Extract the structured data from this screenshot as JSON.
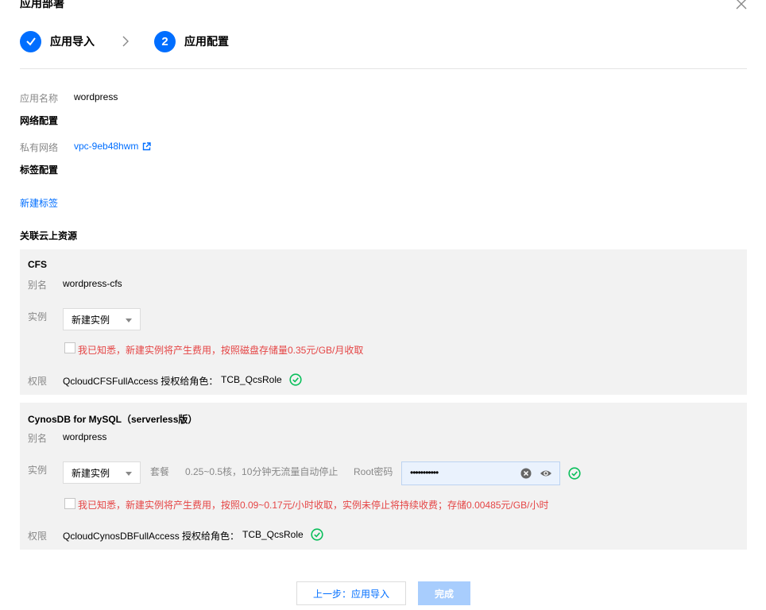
{
  "dialog": {
    "title": "应用部署"
  },
  "steps": [
    {
      "label": "应用导入",
      "state": "done"
    },
    {
      "number": "2",
      "label": "应用配置",
      "state": "active"
    }
  ],
  "app": {
    "name_label": "应用名称",
    "name_value": "wordpress"
  },
  "network": {
    "section_title": "网络配置",
    "vpc_label": "私有网络",
    "vpc_value": "vpc-9eb48hwm"
  },
  "tags": {
    "section_title": "标签配置",
    "new_tag_link": "新建标签"
  },
  "resources": {
    "section_title": "关联云上资源"
  },
  "cfs": {
    "title": "CFS",
    "alias_label": "别名",
    "alias_value": "wordpress-cfs",
    "instance_label": "实例",
    "instance_selected": "新建实例",
    "ack_text": "我已知悉，新建实例将产生费用，按照磁盘存储量0.35元/GB/月收取",
    "perm_label": "权限",
    "perm_text": "QcloudCFSFullAccess 授权给角色：",
    "perm_role": "TCB_QcsRole"
  },
  "cynosdb": {
    "title": "CynosDB for MySQL（serverless版）",
    "alias_label": "别名",
    "alias_value": "wordpress",
    "instance_label": "实例",
    "instance_selected": "新建实例",
    "plan_label": "套餐",
    "plan_value": "0.25~0.5核，10分钟无流量自动停止",
    "root_pwd_label": "Root密码",
    "root_pwd_value": "•••••••••••",
    "ack_text": "我已知悉，新建实例将产生费用，按照0.09~0.17元/小时收取，实例未停止将持续收费；存储0.00485元/GB/小时",
    "perm_label": "权限",
    "perm_text": "QcloudCynosDBFullAccess 授权给角色：",
    "perm_role": "TCB_QcsRole"
  },
  "footer": {
    "prev_button": "上一步：应用导入",
    "finish_button": "完成"
  },
  "colors": {
    "primary": "#006eff",
    "success": "#0abf5b",
    "warning": "#e54545",
    "panel_bg": "#f2f2f2"
  }
}
